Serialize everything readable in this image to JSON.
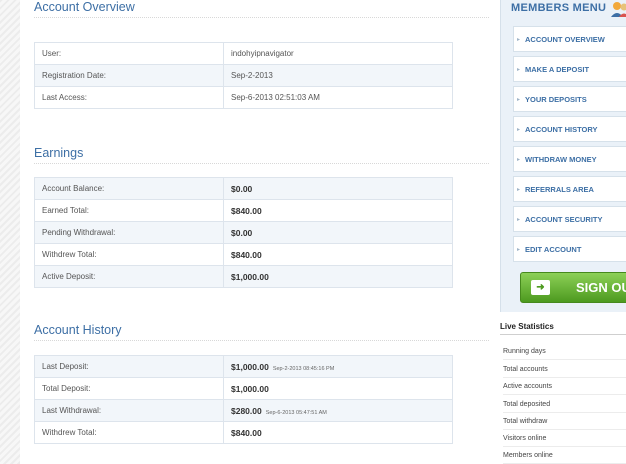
{
  "account_overview": {
    "title": "Account Overview",
    "rows": [
      {
        "label": "User:",
        "value": "indohyipnavigator"
      },
      {
        "label": "Registration Date:",
        "value": "Sep-2-2013"
      },
      {
        "label": "Last Access:",
        "value": "Sep-6-2013 02:51:03 AM"
      }
    ]
  },
  "earnings": {
    "title": "Earnings",
    "rows": [
      {
        "label": "Account Balance:",
        "value": "$0.00"
      },
      {
        "label": "Earned Total:",
        "value": "$840.00"
      },
      {
        "label": "Pending Withdrawal:",
        "value": "$0.00"
      },
      {
        "label": "Withdrew Total:",
        "value": "$840.00"
      },
      {
        "label": "Active Deposit:",
        "value": "$1,000.00"
      }
    ]
  },
  "account_history": {
    "title": "Account History",
    "rows": [
      {
        "label": "Last Deposit:",
        "value": "$1,000.00",
        "timestamp": "Sep-2-2013 08:45:16 PM"
      },
      {
        "label": "Total Deposit:",
        "value": "$1,000.00",
        "timestamp": ""
      },
      {
        "label": "Last Withdrawal:",
        "value": "$280.00",
        "timestamp": "Sep-6-2013 05:47:51 AM"
      },
      {
        "label": "Withdrew Total:",
        "value": "$840.00",
        "timestamp": ""
      }
    ]
  },
  "members_menu": {
    "title": "MEMBERS MENU",
    "icon": "members-icon",
    "items": [
      {
        "label": "ACCOUNT OVERVIEW"
      },
      {
        "label": "MAKE A DEPOSIT"
      },
      {
        "label": "YOUR DEPOSITS"
      },
      {
        "label": "ACCOUNT HISTORY"
      },
      {
        "label": "WITHDRAW MONEY"
      },
      {
        "label": "REFERRALS AREA"
      },
      {
        "label": "ACCOUNT SECURITY"
      },
      {
        "label": "EDIT ACCOUNT"
      }
    ],
    "sign_out": "SIGN OUT",
    "sign_out_icon": "arrow-right-icon"
  },
  "live_statistics": {
    "title": "Live Statistics",
    "items": [
      {
        "label": "Running days"
      },
      {
        "label": "Total accounts"
      },
      {
        "label": "Active accounts"
      },
      {
        "label": "Total deposited"
      },
      {
        "label": "Total withdraw"
      },
      {
        "label": "Visitors online"
      },
      {
        "label": "Members online"
      }
    ]
  },
  "colors": {
    "accent": "#3d6fa5",
    "row_alt": "#f2f6fa",
    "signout_green": "#5fae2a"
  }
}
